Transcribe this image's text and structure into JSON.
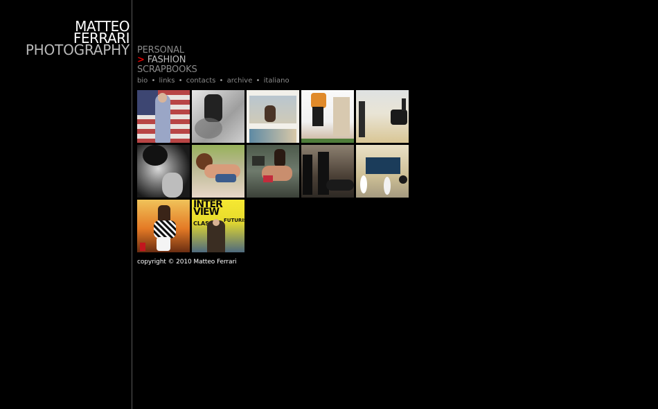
{
  "logo": {
    "line1": "MATTEO",
    "line2": "FERRARI",
    "line3": "PHOTOGRAPHY"
  },
  "nav": {
    "items": [
      {
        "label": "PERSONAL",
        "active": false
      },
      {
        "label": "FASHION",
        "active": true
      },
      {
        "label": "SCRAPBOOKS",
        "active": false
      }
    ],
    "active_marker": ">"
  },
  "subnav": {
    "links": [
      "bio",
      "links",
      "contacts",
      "archive",
      "italiano"
    ],
    "separator": "•"
  },
  "gallery": {
    "thumbnails": [
      {
        "name": "thumb-woman-flag"
      },
      {
        "name": "thumb-bw-jump"
      },
      {
        "name": "thumb-magazine-page"
      },
      {
        "name": "thumb-man-jumping"
      },
      {
        "name": "thumb-desert-car"
      },
      {
        "name": "thumb-bw-portrait"
      },
      {
        "name": "thumb-woman-lying"
      },
      {
        "name": "thumb-woman-posing"
      },
      {
        "name": "thumb-men-car"
      },
      {
        "name": "thumb-garage-surfboards"
      },
      {
        "name": "thumb-woman-sunset"
      },
      {
        "name": "thumb-magazine-cover"
      }
    ],
    "cover_text": {
      "big": "INTER VIEW",
      "sub1": "CLASSIC",
      "sub2": "FUTURISM"
    }
  },
  "footer": {
    "copyright": "copyright © 2010 Matteo Ferrari"
  },
  "colors": {
    "background": "#000000",
    "accent": "#e00000",
    "divider": "#5a5a5a"
  }
}
